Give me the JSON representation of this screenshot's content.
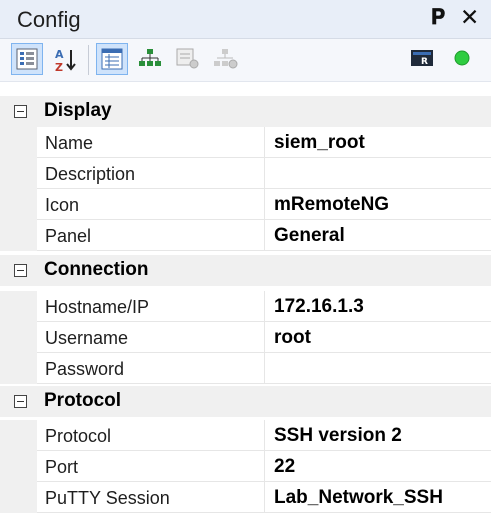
{
  "window": {
    "title": "Config",
    "pin_glyph": "1",
    "close_glyph": "✕"
  },
  "toolbar": {
    "buttons": [
      {
        "icon": "categorized-view-icon",
        "active": false
      },
      {
        "icon": "sort-az-icon",
        "active": false
      },
      {
        "icon": "properties-icon",
        "active": true
      },
      {
        "icon": "inheritance-icon",
        "active": false
      },
      {
        "icon": "default-properties-icon",
        "active": false,
        "disabled": true
      },
      {
        "icon": "default-inheritance-icon",
        "active": false,
        "disabled": true
      },
      {
        "icon": "host-status-icon",
        "active": false
      },
      {
        "icon": "status-online-icon",
        "active": false
      }
    ],
    "status_color": "#2ecc40"
  },
  "grid": {
    "categories": [
      {
        "label": "Display",
        "properties": [
          {
            "name": "Name",
            "value": "siem_root"
          },
          {
            "name": "Description",
            "value": ""
          },
          {
            "name": "Icon",
            "value": "mRemoteNG"
          },
          {
            "name": "Panel",
            "value": "General"
          }
        ]
      },
      {
        "label": "Connection",
        "properties": [
          {
            "name": "Hostname/IP",
            "value": "172.16.1.3"
          },
          {
            "name": "Username",
            "value": "root"
          },
          {
            "name": "Password",
            "value": ""
          }
        ]
      },
      {
        "label": "Protocol",
        "properties": [
          {
            "name": "Protocol",
            "value": "SSH version 2"
          },
          {
            "name": "Port",
            "value": "22"
          },
          {
            "name": "PuTTY Session",
            "value": "Lab_Network_SSH"
          }
        ]
      }
    ]
  }
}
